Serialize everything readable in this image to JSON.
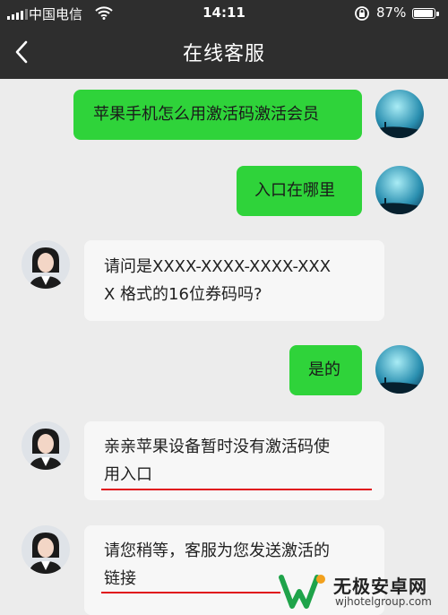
{
  "status_bar": {
    "carrier": "中国电信",
    "time": "14:11",
    "battery": "87%",
    "battery_level": 0.87
  },
  "header": {
    "title": "在线客服"
  },
  "messages": [
    {
      "sender": "user",
      "text": "苹果手机怎么用激活码激活会员"
    },
    {
      "sender": "user",
      "text": "入口在哪里"
    },
    {
      "sender": "agent",
      "lines": [
        "请问是XXXX-XXXX-XXXX-XXX",
        "X 格式的16位券码吗?"
      ]
    },
    {
      "sender": "user",
      "text": "是的"
    },
    {
      "sender": "agent",
      "lines": [
        "亲亲苹果设备暂时没有激活码使",
        "用入口"
      ]
    },
    {
      "sender": "agent",
      "lines": [
        "请您稍等，客服为您发送激活的",
        "链接"
      ]
    }
  ],
  "watermark": {
    "name": "无极安卓网",
    "url": "wjhotelgroup.com"
  },
  "colors": {
    "header_bg": "#2e2e2e",
    "chat_bg": "#ececec",
    "user_bubble": "#2fd33a",
    "agent_bubble": "#f7f7f7",
    "annotation": "#e0101b"
  }
}
